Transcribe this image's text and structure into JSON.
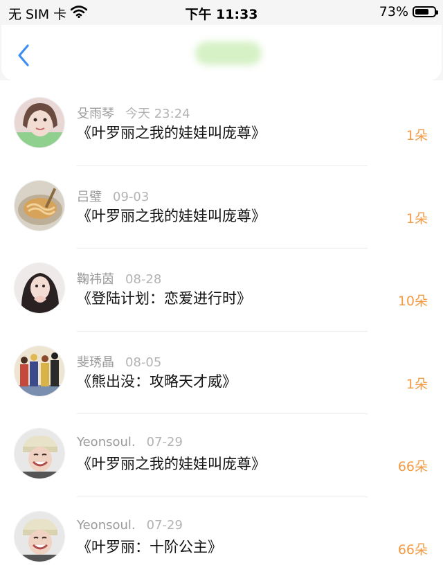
{
  "status_bar": {
    "carrier": "无 SIM 卡",
    "time": "下午 11:33",
    "battery_percent": "73%",
    "battery_level": 0.73
  },
  "nav": {
    "back_icon": "chevron-left-icon"
  },
  "colors": {
    "accent": "#f39a45",
    "back_arrow": "#3d8ff2",
    "name": "#9a9a9a",
    "date": "#b3b3b3"
  },
  "items": [
    {
      "name": "殳雨琴",
      "date": "今天 23:24",
      "title": "《叶罗丽之我的娃娃叫庞尊》",
      "count": "1朵"
    },
    {
      "name": "吕璧",
      "date": "09-03",
      "title": "《叶罗丽之我的娃娃叫庞尊》",
      "count": "1朵"
    },
    {
      "name": "鞠祎茵",
      "date": "08-28",
      "title": "《登陆计划：恋爱进行时》",
      "count": "10朵"
    },
    {
      "name": "斐琇晶",
      "date": "08-05",
      "title": "《熊出没：攻略天才威》",
      "count": "1朵"
    },
    {
      "name": "Yeonsoul.",
      "date": "07-29",
      "title": "《叶罗丽之我的娃娃叫庞尊》",
      "count": "66朵"
    },
    {
      "name": "Yeonsoul.",
      "date": "07-29",
      "title": "《叶罗丽：十阶公主》",
      "count": "66朵"
    }
  ]
}
